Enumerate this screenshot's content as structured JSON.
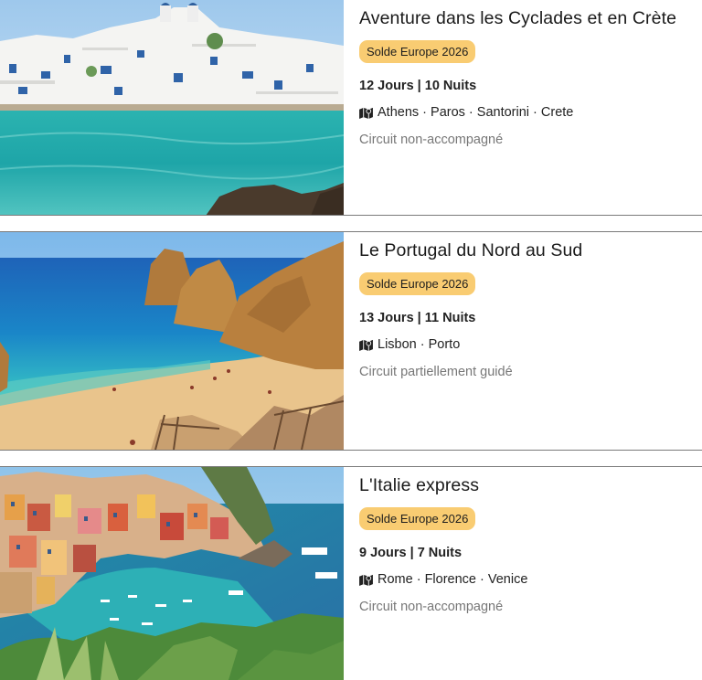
{
  "trips": [
    {
      "title": "Aventure dans les Cyclades et en Crète",
      "badge": "Solde Europe 2026",
      "duration": "12 Jours | 10 Nuits",
      "route": "Athens · Paros · Santorini · Crete",
      "tour_type": "Circuit non-accompagné"
    },
    {
      "title": "Le Portugal du Nord au Sud",
      "badge": "Solde Europe 2026",
      "duration": "13 Jours | 11 Nuits",
      "route": "Lisbon · Porto",
      "tour_type": "Circuit partiellement guidé"
    },
    {
      "title": "L'Italie express",
      "badge": "Solde Europe 2026",
      "duration": "9 Jours | 7 Nuits",
      "route": "Rome · Florence · Venice",
      "tour_type": "Circuit non-accompagné"
    }
  ],
  "icons": {
    "route": "map-icon"
  },
  "colors": {
    "badge_bg": "#f9cc72",
    "divider": "#7a7a7a",
    "muted_text": "#777777"
  }
}
